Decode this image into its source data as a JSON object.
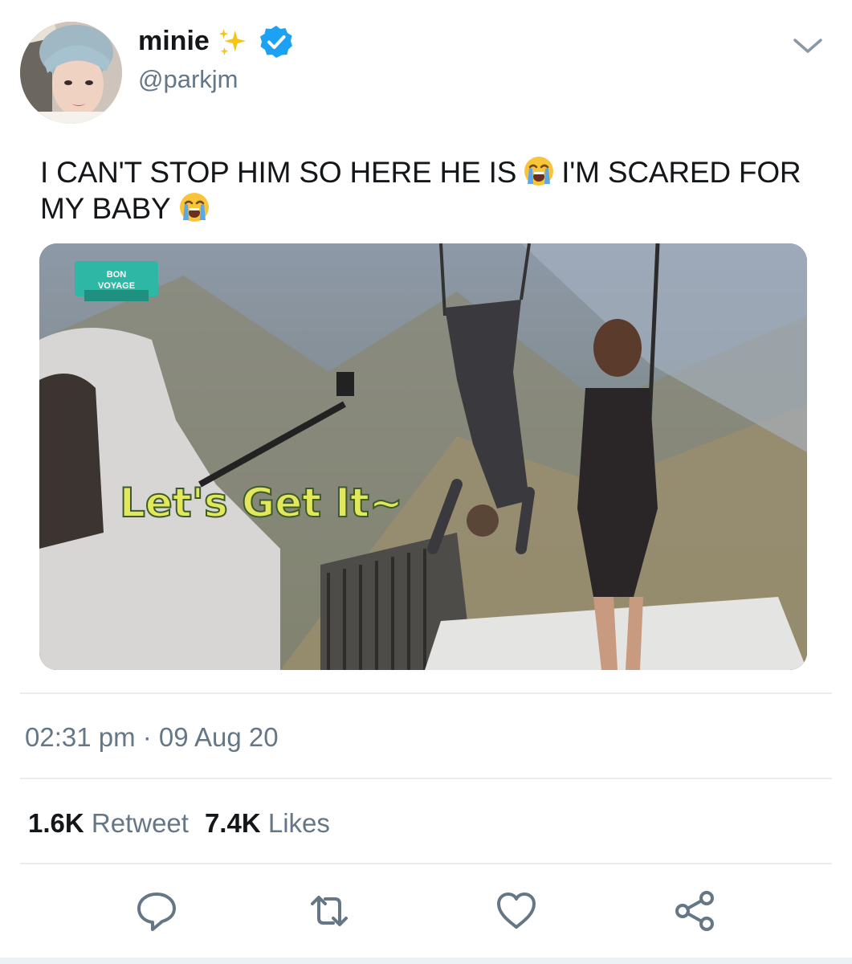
{
  "author": {
    "display_name": "minie",
    "handle": "@parkjm",
    "verified": true,
    "avatar_icon": "profile-photo"
  },
  "tweet": {
    "text_part1": "I CAN'T STOP HIM SO HERE HE IS",
    "text_part2": "I'M SCARED FOR MY BABY",
    "emoji": "loudly-crying-face"
  },
  "media": {
    "caption_overlay": "Let's Get It~",
    "logo_line1": "BON",
    "logo_line2": "VOYAGE"
  },
  "meta": {
    "timestamp": "02:31 pm · 09 Aug 20"
  },
  "stats": {
    "retweets_count": "1.6K",
    "retweets_label": "Retweet",
    "likes_count": "7.4K",
    "likes_label": "Likes"
  },
  "actions": {
    "reply_icon": "reply-icon",
    "retweet_icon": "retweet-icon",
    "like_icon": "heart-icon",
    "share_icon": "share-icon"
  },
  "colors": {
    "verified_blue": "#1da1f2",
    "secondary_text": "#657786",
    "divider": "#e6ecf0"
  }
}
